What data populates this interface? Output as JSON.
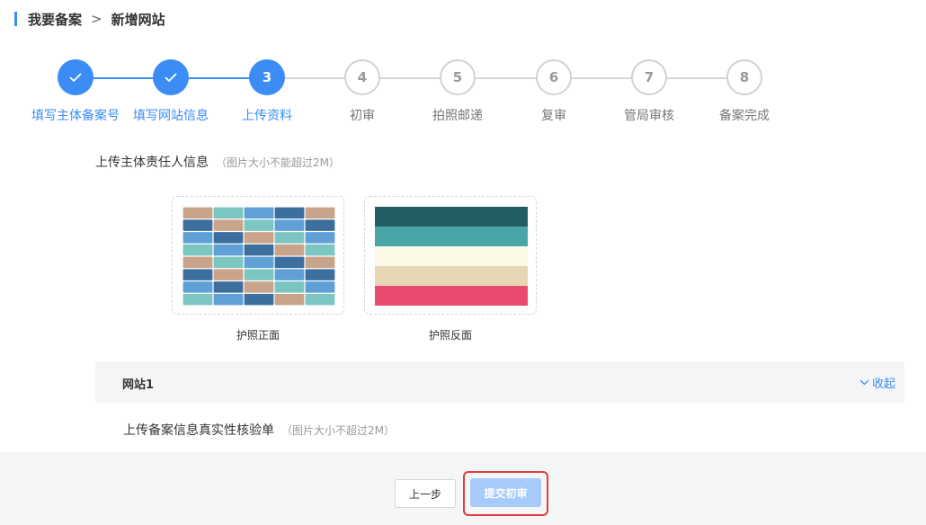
{
  "breadcrumb": {
    "parent": "我要备案",
    "separator": ">",
    "current": "新增网站"
  },
  "steps": [
    {
      "label": "填写主体备案号",
      "number": "1",
      "status": "done"
    },
    {
      "label": "填写网站信息",
      "number": "2",
      "status": "done"
    },
    {
      "label": "上传资料",
      "number": "3",
      "status": "active"
    },
    {
      "label": "初审",
      "number": "4",
      "status": "todo"
    },
    {
      "label": "拍照邮递",
      "number": "5",
      "status": "todo"
    },
    {
      "label": "复审",
      "number": "6",
      "status": "todo"
    },
    {
      "label": "管局审核",
      "number": "7",
      "status": "todo"
    },
    {
      "label": "备案完成",
      "number": "8",
      "status": "todo"
    }
  ],
  "owner_section": {
    "title": "上传主体责任人信息",
    "hint": "（图片大小不能超过2M）"
  },
  "uploads": [
    {
      "caption": "护照正面",
      "image": "colorful-mosaic"
    },
    {
      "caption": "护照反面",
      "image": "color-stripes"
    }
  ],
  "site_panel": {
    "name": "网站1",
    "toggle_label": "收起"
  },
  "site_section": {
    "title": "上传备案信息真实性核验单",
    "hint": "（图片大小不超过2M）"
  },
  "footer": {
    "prev_label": "上一步",
    "submit_label": "提交初审"
  },
  "colors": {
    "accent": "#3b8cf5",
    "highlight": "#e23c3c",
    "submit_disabled": "#a6cbfb"
  },
  "icons": {
    "done": "check-icon",
    "collapse": "chevron-down-icon"
  }
}
